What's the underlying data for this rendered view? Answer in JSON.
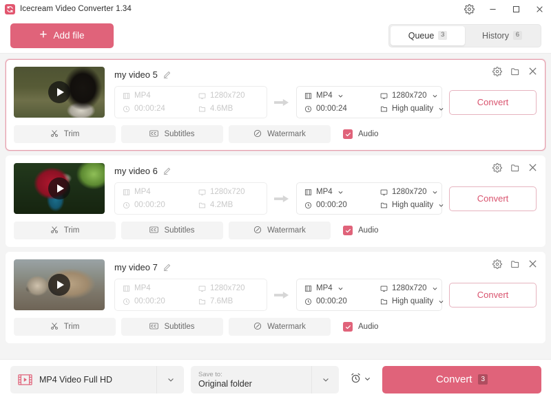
{
  "window": {
    "title": "Icecream Video Converter 1.34",
    "logo_icon": "refresh-loop-icon",
    "settings_icon": "gear-icon",
    "minimize_icon": "minimize-icon",
    "maximize_icon": "maximize-icon",
    "close_icon": "close-icon",
    "accent_color": "#e0637a",
    "accent_outline_color": "#d9536e"
  },
  "toolbar": {
    "add_file_label": "Add file",
    "add_file_icon": "plus-icon",
    "tabs": [
      {
        "label": "Queue",
        "badge": "3",
        "active": true
      },
      {
        "label": "History",
        "badge": "6",
        "active": false
      }
    ]
  },
  "queue": {
    "cards": [
      {
        "name": "my video 5",
        "selected": true,
        "edit_icon": "pencil-icon",
        "thumbnail_alt": "cormorant-bird-video-thumbnail",
        "play_icon": "play-icon",
        "source": {
          "format": "MP4",
          "format_icon": "film-icon",
          "resolution": "1280x720",
          "resolution_icon": "monitor-icon",
          "duration": "00:00:24",
          "duration_icon": "clock-icon",
          "size": "4.6MB",
          "size_icon": "folder-icon"
        },
        "target": {
          "format": "MP4",
          "format_icon": "film-icon",
          "resolution": "1280x720",
          "resolution_icon": "monitor-icon",
          "duration": "00:00:24",
          "duration_icon": "clock-icon",
          "quality": "High quality",
          "quality_icon": "folder-icon"
        },
        "convert_label": "Convert",
        "actions": {
          "trim_label": "Trim",
          "trim_icon": "scissors-icon",
          "subtitles_label": "Subtitles",
          "subtitles_icon": "cc-icon",
          "watermark_label": "Watermark",
          "watermark_icon": "watermark-icon",
          "audio_label": "Audio",
          "audio_checked": true
        },
        "icons": {
          "settings": "gear-icon",
          "folder": "folder-open-icon",
          "remove": "close-icon"
        }
      },
      {
        "name": "my video 6",
        "selected": false,
        "edit_icon": "pencil-icon",
        "thumbnail_alt": "red-macaw-parrot-video-thumbnail",
        "play_icon": "play-icon",
        "source": {
          "format": "MP4",
          "format_icon": "film-icon",
          "resolution": "1280x720",
          "resolution_icon": "monitor-icon",
          "duration": "00:00:20",
          "duration_icon": "clock-icon",
          "size": "4.2MB",
          "size_icon": "folder-icon"
        },
        "target": {
          "format": "MP4",
          "format_icon": "film-icon",
          "resolution": "1280x720",
          "resolution_icon": "monitor-icon",
          "duration": "00:00:20",
          "duration_icon": "clock-icon",
          "quality": "High quality",
          "quality_icon": "folder-icon"
        },
        "convert_label": "Convert",
        "actions": {
          "trim_label": "Trim",
          "trim_icon": "scissors-icon",
          "subtitles_label": "Subtitles",
          "subtitles_icon": "cc-icon",
          "watermark_label": "Watermark",
          "watermark_icon": "watermark-icon",
          "audio_label": "Audio",
          "audio_checked": true
        },
        "icons": {
          "settings": "gear-icon",
          "folder": "folder-open-icon",
          "remove": "close-icon"
        }
      },
      {
        "name": "my video 7",
        "selected": false,
        "edit_icon": "pencil-icon",
        "thumbnail_alt": "raccoon-video-thumbnail",
        "play_icon": "play-icon",
        "source": {
          "format": "MP4",
          "format_icon": "film-icon",
          "resolution": "1280x720",
          "resolution_icon": "monitor-icon",
          "duration": "00:00:20",
          "duration_icon": "clock-icon",
          "size": "7.6MB",
          "size_icon": "folder-icon"
        },
        "target": {
          "format": "MP4",
          "format_icon": "film-icon",
          "resolution": "1280x720",
          "resolution_icon": "monitor-icon",
          "duration": "00:00:20",
          "duration_icon": "clock-icon",
          "quality": "High quality",
          "quality_icon": "folder-icon"
        },
        "convert_label": "Convert",
        "actions": {
          "trim_label": "Trim",
          "trim_icon": "scissors-icon",
          "subtitles_label": "Subtitles",
          "subtitles_icon": "cc-icon",
          "watermark_label": "Watermark",
          "watermark_icon": "watermark-icon",
          "audio_label": "Audio",
          "audio_checked": true
        },
        "icons": {
          "settings": "gear-icon",
          "folder": "folder-open-icon",
          "remove": "close-icon"
        }
      }
    ]
  },
  "bottombar": {
    "format_value": "MP4 Video Full HD",
    "format_icon": "film-play-icon",
    "format_chevron_icon": "chevron-down-icon",
    "saveto_label": "Save to:",
    "saveto_value": "Original folder",
    "saveto_chevron_icon": "chevron-down-icon",
    "timer_icon": "alarm-clock-icon",
    "timer_chevron_icon": "chevron-down-icon",
    "convert_label": "Convert",
    "convert_badge": "3"
  }
}
